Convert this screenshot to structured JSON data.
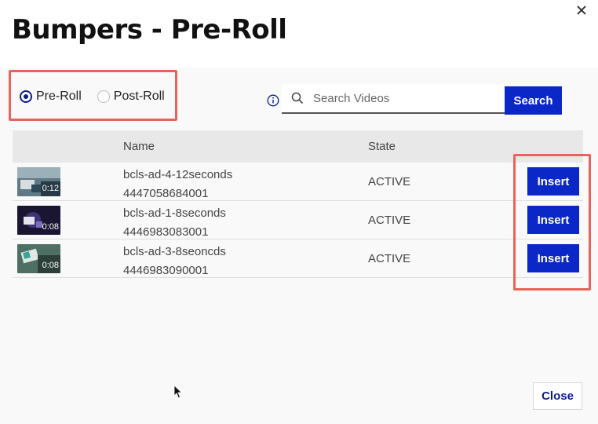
{
  "dialog": {
    "title": "Bumpers - Pre-Roll"
  },
  "radio_options": [
    {
      "label": "Pre-Roll",
      "selected": true
    },
    {
      "label": "Post-Roll",
      "selected": false
    }
  ],
  "search": {
    "placeholder": "Search Videos",
    "value": "",
    "button_label": "Search"
  },
  "table": {
    "columns": [
      "",
      "Name",
      "State",
      ""
    ],
    "rows": [
      {
        "duration": "0:12",
        "name": "bcls-ad-4-12seconds",
        "id": "4447058684001",
        "state": "ACTIVE",
        "action": "Insert"
      },
      {
        "duration": "0:08",
        "name": "bcls-ad-1-8seconds",
        "id": "4446983083001",
        "state": "ACTIVE",
        "action": "Insert"
      },
      {
        "duration": "0:08",
        "name": "bcls-ad-3-8seoncds",
        "id": "4446983090001",
        "state": "ACTIVE",
        "action": "Insert"
      }
    ]
  },
  "footer": {
    "close_label": "Close"
  },
  "colors": {
    "primary": "#0b27c7",
    "radio_selected": "#0b1e86",
    "annotation_box": "#e8645a"
  },
  "icons": {
    "close": "close-icon",
    "info": "info-icon",
    "search": "search-icon",
    "cursor": "mouse-cursor-icon"
  }
}
